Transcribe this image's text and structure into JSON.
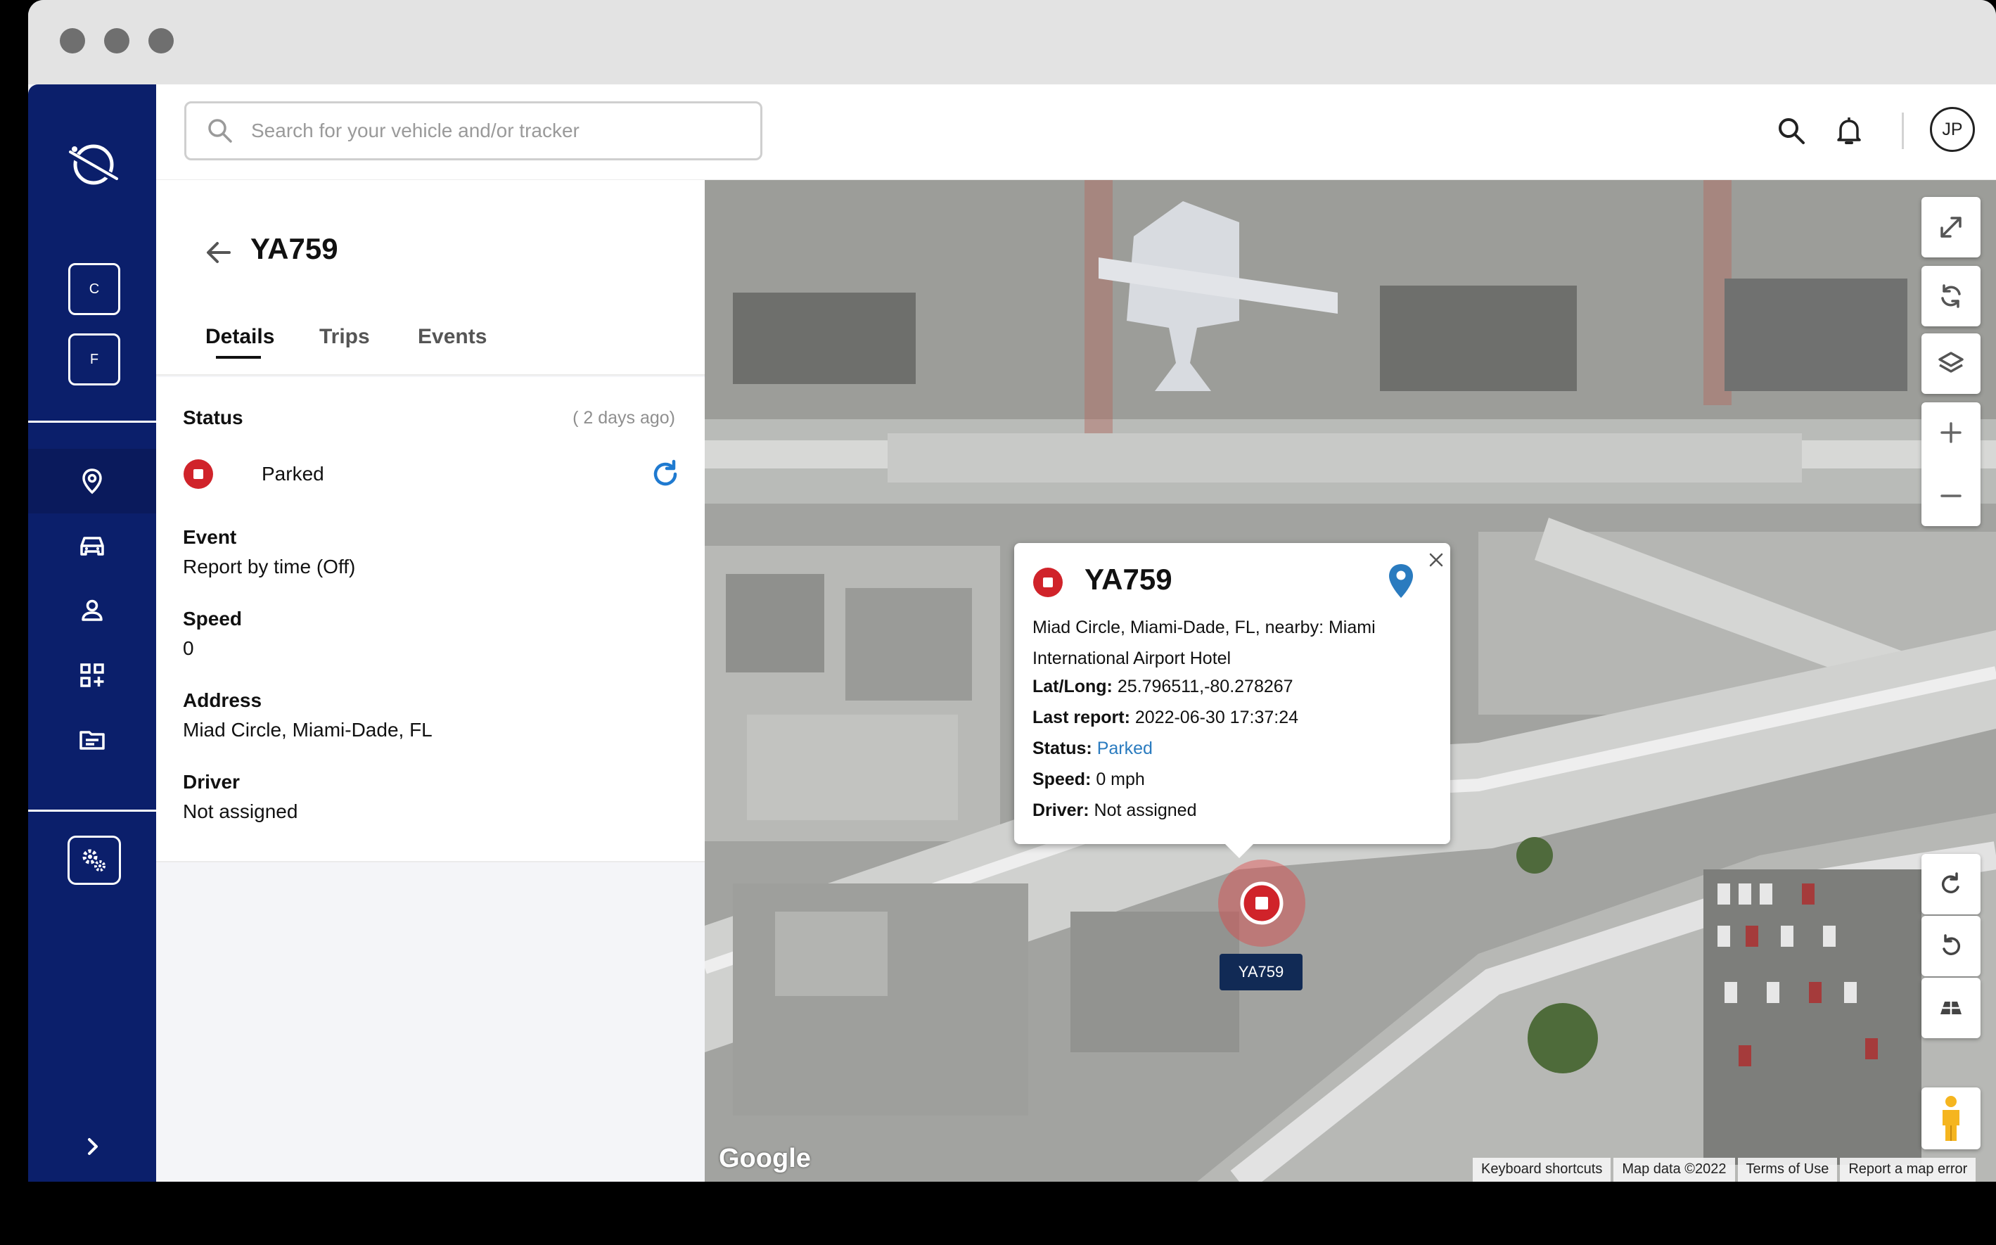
{
  "search": {
    "placeholder": "Search for your vehicle and/or tracker"
  },
  "sidebar": {
    "chips": [
      "C",
      "F"
    ],
    "nav": [
      "location",
      "vehicles",
      "drivers",
      "apps",
      "reports"
    ]
  },
  "header": {
    "avatar_initials": "JP"
  },
  "panel": {
    "vehicle_id": "YA759",
    "tabs": [
      "Details",
      "Trips",
      "Events"
    ],
    "status_heading": "Status",
    "status_ago": "( 2 days ago)",
    "status_text": "Parked",
    "fields": [
      {
        "label": "Event",
        "value": "Report by time (Off)"
      },
      {
        "label": "Speed",
        "value": "0"
      },
      {
        "label": "Address",
        "value": "Miad Circle, Miami-Dade, FL"
      },
      {
        "label": "Driver",
        "value": "Not assigned"
      }
    ]
  },
  "popup": {
    "title": "YA759",
    "address": "Miad Circle, Miami-Dade, FL, nearby: Miami International Airport Hotel",
    "latlong_label": "Lat/Long:",
    "latlong_value": "25.796511,-80.278267",
    "last_report_label": "Last report:",
    "last_report_value": "2022-06-30 17:37:24",
    "status_label": "Status:",
    "status_value": "Parked",
    "speed_label": "Speed:",
    "speed_value": "0 mph",
    "driver_label": "Driver:",
    "driver_value": "Not assigned"
  },
  "map": {
    "marker_label": "YA759",
    "google_logo": "Google",
    "footer": [
      "Keyboard shortcuts",
      "Map data ©2022",
      "Terms of Use",
      "Report a map error"
    ]
  },
  "colors": {
    "sidebar": "#0b1f6b",
    "status_red": "#d0232a",
    "accent_blue": "#2a7bbf"
  }
}
